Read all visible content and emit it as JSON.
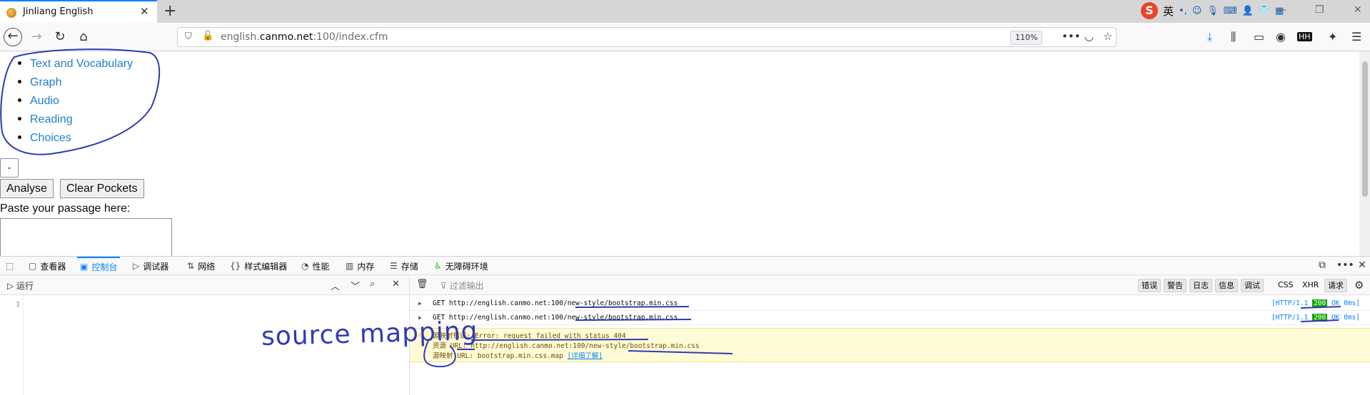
{
  "browser": {
    "tab_title": "Jinliang English",
    "url_host_prefix": "english.",
    "url_host_main": "canmo.net",
    "url_rest": ":100/index.cfm",
    "zoom": "110%"
  },
  "ime": {
    "lang": "英",
    "punct": "•,"
  },
  "page": {
    "menu": [
      "Text and Vocabulary",
      "Graph",
      "Audio",
      "Reading",
      "Choices"
    ],
    "analyse_label": "Analyse",
    "clear_label": "Clear Pockets",
    "paste_label": "Paste your passage here:"
  },
  "devtools": {
    "tabs": [
      "查看器",
      "控制台",
      "调试器",
      "网络",
      "样式编辑器",
      "性能",
      "内存",
      "存储",
      "无障碍环境"
    ],
    "run_label": "运行",
    "filter_placeholder": "过滤输出",
    "filters": [
      "错误",
      "警告",
      "日志",
      "信息",
      "调试",
      "CSS",
      "XHR",
      "请求"
    ],
    "line_number": "1",
    "logs": [
      {
        "text": "GET http://english.canmo.net:100/new-style/bootstrap.min.css",
        "status_pre": "[HTTP/1.1 ",
        "code": "200",
        "status_post": " OK 0ms]"
      },
      {
        "text": "GET http://english.canmo.net:100/new-style/bootstrap.min.css",
        "status_pre": "[HTTP/1.1 ",
        "code": "200",
        "status_post": " OK 0ms]"
      }
    ],
    "warning": {
      "line1": "源映射错误: Error: request failed with status 404",
      "line2": "资源 URL: http://english.canmo.net:100/new-style/bootstrap.min.css",
      "line3_pre": "源映射 URL: bootstrap.min.css.map ",
      "line3_link": "[详细了解]"
    }
  },
  "annotation": {
    "text": "source mapping"
  }
}
